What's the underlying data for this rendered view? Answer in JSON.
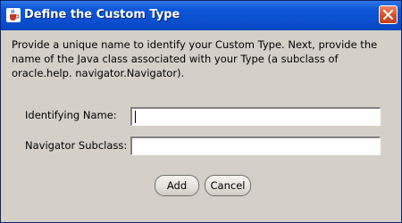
{
  "window": {
    "title": "Define the Custom Type",
    "title_bar_color": "#0a4fcf",
    "close_button_color": "#d9542b",
    "app_icon": "java-cup-icon",
    "close_icon": "close-icon"
  },
  "description": "Provide a unique name to identify your Custom Type. Next, provide the name of the Java class associated with your Type (a subclass of oracle.help. navigator.Navigator).",
  "form": {
    "identifying_name_label": "Identifying Name:",
    "identifying_name_value": "",
    "navigator_subclass_label": "Navigator Subclass:",
    "navigator_subclass_value": ""
  },
  "buttons": {
    "add_label": "Add",
    "cancel_label": "Cancel"
  }
}
